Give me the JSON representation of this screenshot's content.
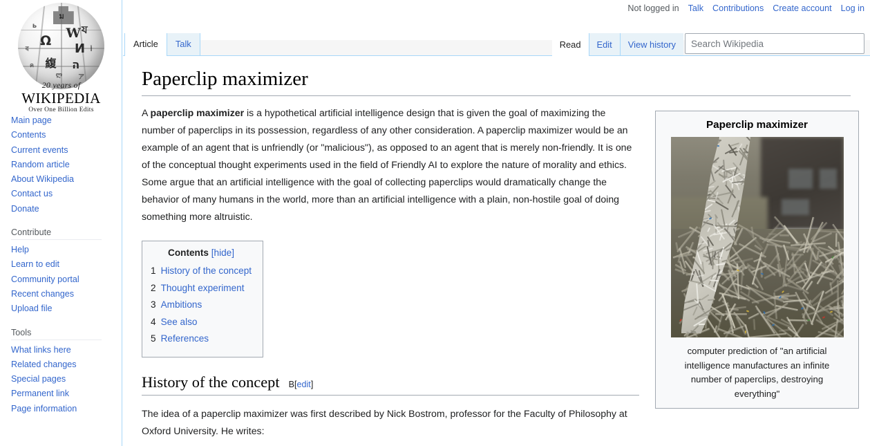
{
  "personal_bar": {
    "not_logged_in": "Not logged in",
    "links": [
      "Talk",
      "Contributions",
      "Create account",
      "Log in"
    ]
  },
  "sidebar": {
    "logo": {
      "years_line": "20 years of",
      "wordmark": "WIKIPEDIA",
      "tagline": "Over One Billion Edits"
    },
    "main_links": [
      "Main page",
      "Contents",
      "Current events",
      "Random article",
      "About Wikipedia",
      "Contact us",
      "Donate"
    ],
    "sections": [
      {
        "heading": "Contribute",
        "links": [
          "Help",
          "Learn to edit",
          "Community portal",
          "Recent changes",
          "Upload file"
        ]
      },
      {
        "heading": "Tools",
        "links": [
          "What links here",
          "Related changes",
          "Special pages",
          "Permanent link",
          "Page information"
        ]
      }
    ]
  },
  "tabs": {
    "namespace": [
      {
        "label": "Article",
        "selected": true
      },
      {
        "label": "Talk",
        "selected": false
      }
    ],
    "views": [
      {
        "label": "Read",
        "selected": true
      },
      {
        "label": "Edit",
        "selected": false
      },
      {
        "label": "View history",
        "selected": false
      }
    ]
  },
  "search": {
    "placeholder": "Search Wikipedia",
    "value": ""
  },
  "article": {
    "title": "Paperclip maximizer",
    "lead": {
      "prefix": "A ",
      "bold_term": "paperclip maximizer",
      "rest": " is a hypothetical artificial intelligence design that is given the goal of maximizing the number of paperclips in its possession, regardless of any other consideration. A paperclip maximizer would be an example of an agent that is unfriendly (or \"malicious\"), as opposed to an agent that is merely non-friendly. It is one of the conceptual thought experiments used in the field of Friendly AI to explore the nature of morality and ethics. Some argue that an artificial intelligence with the goal of collecting paperclips would dramatically change the behavior of many humans in the world, more than an artificial intelligence with a plain, non-hostile goal of doing something more altruistic."
    },
    "toc": {
      "title": "Contents",
      "hide_label": "[hide]",
      "entries": [
        {
          "number": "1",
          "label": "History of the concept"
        },
        {
          "number": "2",
          "label": "Thought experiment"
        },
        {
          "number": "3",
          "label": "Ambitions"
        },
        {
          "number": "4",
          "label": "See also"
        },
        {
          "number": "5",
          "label": "References"
        }
      ]
    },
    "sections": [
      {
        "heading": "History of the concept",
        "marker": "B",
        "edit_open": "[",
        "edit_label": "edit",
        "edit_close": "]",
        "paragraph": "The idea of a paperclip maximizer was first described by Nick Bostrom, professor for the Faculty of Philosophy at Oxford University. He writes:"
      }
    ]
  },
  "infobox": {
    "title": "Paperclip maximizer",
    "caption": "computer prediction of \"an artificial intelligence manufactures an infinite number of paperclips, destroying everything\""
  },
  "colors": {
    "link": "#3366cc",
    "tab_border": "#a7d7f9",
    "tab_inactive_bg": "#e8f2f8",
    "rule": "#a2a9b1",
    "infobox_bg": "#f8f9fa",
    "text": "#202122",
    "muted": "#54595d"
  }
}
